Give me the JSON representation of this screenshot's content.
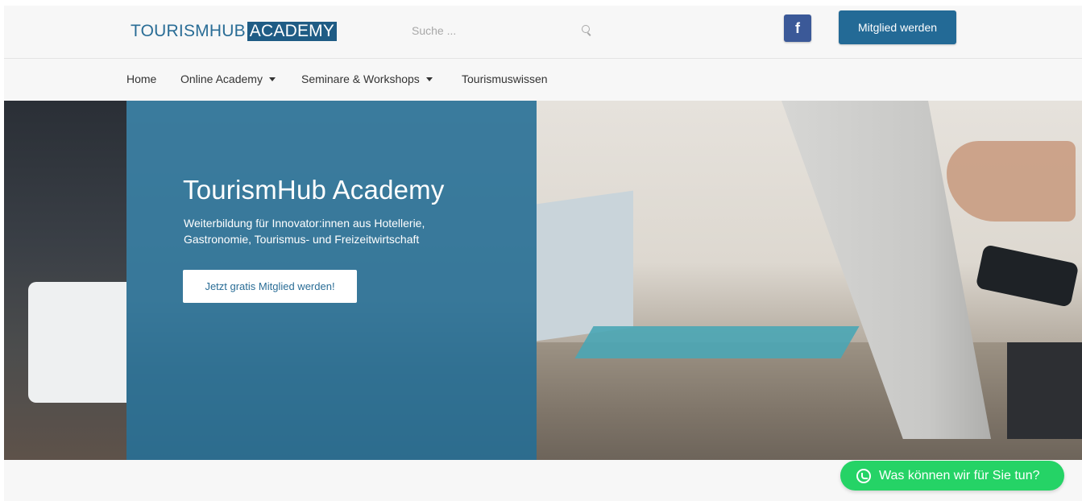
{
  "header": {
    "logo_part1": "TOURISMHUB",
    "logo_part2": "ACADEMY",
    "search_placeholder": "Suche ...",
    "search_icon": "search-icon",
    "facebook_label": "f",
    "facebook_icon": "facebook-icon",
    "join_label": "Mitglied werden",
    "brand_color": "#236a96",
    "facebook_color": "#3b5998"
  },
  "nav": {
    "items": [
      {
        "label": "Home",
        "has_dropdown": false
      },
      {
        "label": "Online Academy",
        "has_dropdown": true
      },
      {
        "label": "Seminare & Workshops",
        "has_dropdown": true
      },
      {
        "label": "Tourismuswissen",
        "has_dropdown": false
      }
    ]
  },
  "hero": {
    "title": "TourismHub Academy",
    "subtitle_line1": "Weiterbildung für Innovator:innen aus Hotellerie,",
    "subtitle_line2": "Gastronomie, Tourismus- und Freizeitwirtschaft",
    "cta_label": "Jetzt gratis Mitglied werden!",
    "overlay_color": "#226e96"
  },
  "chat": {
    "label": "Was können wir für Sie tun?",
    "icon": "whatsapp-icon",
    "color": "#25d366"
  }
}
